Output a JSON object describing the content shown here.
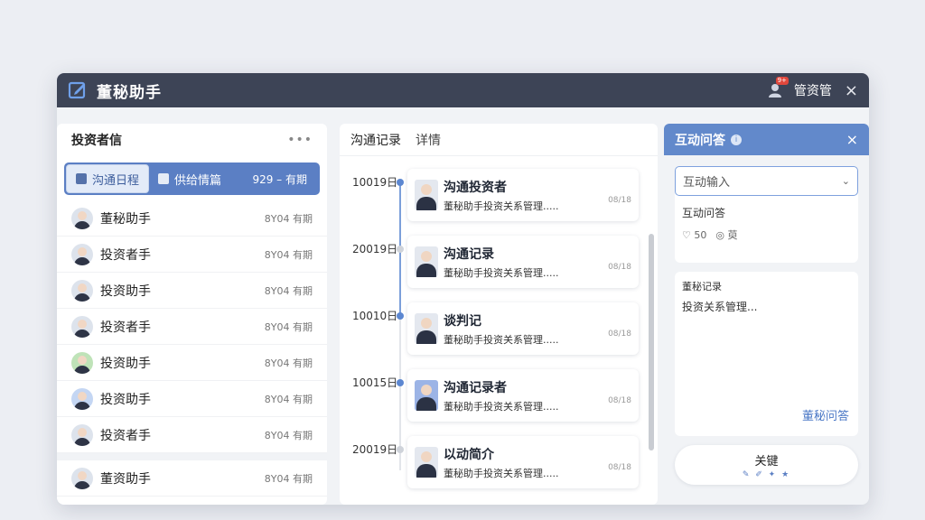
{
  "window": {
    "title": "董秘助手",
    "badge": "9+",
    "user_label": "管资管",
    "close": "×"
  },
  "left": {
    "title": "投资者信",
    "menu": "•••",
    "tabs": [
      {
        "label": "沟通日程"
      },
      {
        "label": "供给情篇"
      }
    ],
    "tab_date": "929 – 有期",
    "investors": [
      {
        "name": "董秘助手",
        "date": "8Y04 有期",
        "avatar": "default"
      },
      {
        "name": "投资者手",
        "date": "8Y04 有期",
        "avatar": "default"
      },
      {
        "name": "投资助手",
        "date": "8Y04 有期",
        "avatar": "default"
      },
      {
        "name": "投资者手",
        "date": "8Y04 有期",
        "avatar": "default"
      },
      {
        "name": "投资助手",
        "date": "8Y04 有期",
        "avatar": "green"
      },
      {
        "name": "投资助手",
        "date": "8Y04 有期",
        "avatar": "blue"
      },
      {
        "name": "投资者手",
        "date": "8Y04 有期",
        "avatar": "default"
      },
      {
        "name": "董资助手",
        "date": "8Y04 有期",
        "avatar": "default"
      }
    ]
  },
  "middle": {
    "tab_main": "沟通记录",
    "tab_sub": "详情",
    "entries": [
      {
        "date": "10019日",
        "title": "沟通投资者",
        "desc": "董秘助手投资关系管理.....",
        "meta": "08/18",
        "dot": "blue",
        "avatar": "default"
      },
      {
        "date": "20019日",
        "title": "沟通记录",
        "desc": "董秘助手投资关系管理.....",
        "meta": "08/18",
        "dot": "gray",
        "avatar": "default"
      },
      {
        "date": "10010日",
        "title": "谈判记",
        "desc": "董秘助手投资关系管理.....",
        "meta": "08/18",
        "dot": "blue",
        "avatar": "default"
      },
      {
        "date": "10015日",
        "title": "沟通记录者",
        "desc": "董秘助手投资关系管理.....",
        "meta": "08/18",
        "dot": "blue",
        "avatar": "blue"
      },
      {
        "date": "20019日",
        "title": "以动简介",
        "desc": "董秘助手投资关系管理.....",
        "meta": "08/18",
        "dot": "gray",
        "avatar": "default"
      }
    ]
  },
  "right": {
    "title": "互动问答",
    "close": "×",
    "select_placeholder": "互动输入",
    "subtitle": "互动问答",
    "likes": "♡ 50",
    "views": "◎ 萸",
    "note_head": "董秘记录",
    "note_body": "投资关系管理...",
    "note_link": "董秘问答",
    "send_label": "关键",
    "send_icons": "✎ ✐ ✦ ★"
  },
  "colors": {
    "titlebar": "#3d4456",
    "accent": "#5b7fc4",
    "qa_header": "#6289cb"
  }
}
